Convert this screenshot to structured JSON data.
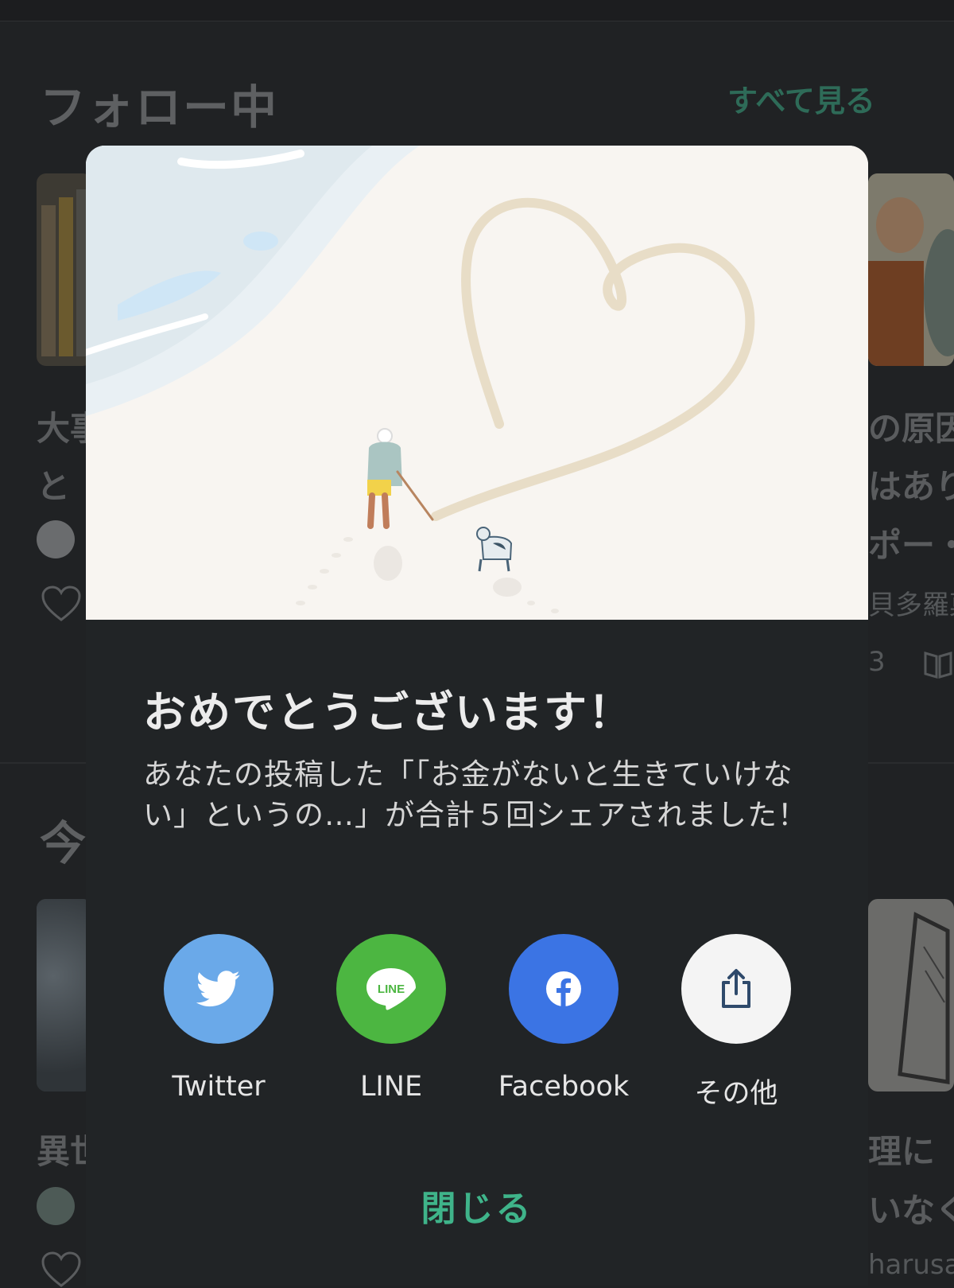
{
  "background": {
    "following_title": "フォロー中",
    "see_all": "すべて見る",
    "today_title": "今",
    "left_card1_line1": "大事",
    "left_card1_line2": "と",
    "left_card2_line1": "異世",
    "right_card1_line1": "の原因",
    "right_card1_line2": "はあり",
    "right_card1_line3": "ポー・",
    "right_card1_author": "貝多羅菓",
    "right_card1_count": "3",
    "right_card2_line1": "理に「",
    "right_card2_line2": "いなく",
    "right_card2_author": "harusa"
  },
  "modal": {
    "title": "おめでとうございます！",
    "message": "あなたの投稿した「「お金がないと生きていけない」というの…」が合計５回シェアされました！",
    "share_options": [
      {
        "label": "Twitter",
        "color": "#6aa9e9",
        "icon": "twitter-bird-icon"
      },
      {
        "label": "LINE",
        "color": "#4cb641",
        "icon": "line-icon"
      },
      {
        "label": "Facebook",
        "color": "#3b74e4",
        "icon": "facebook-icon"
      },
      {
        "label": "その他",
        "color": "#f4f4f4",
        "icon": "share-icon"
      }
    ],
    "line_icon_text": "LINE",
    "close_label": "閉じる",
    "accent_color": "#3fb48a"
  }
}
